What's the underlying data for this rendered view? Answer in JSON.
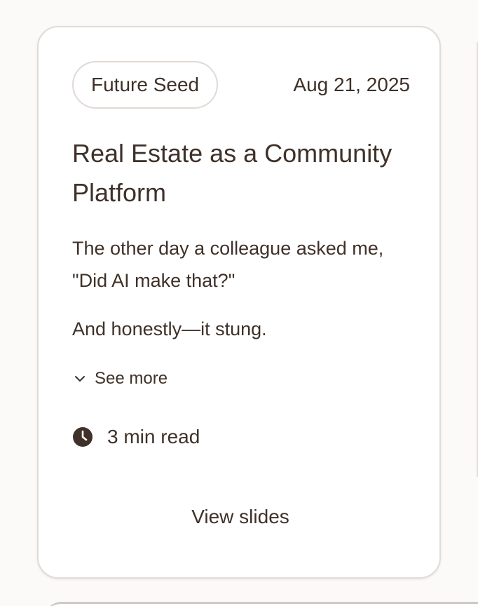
{
  "card": {
    "tag": "Future Seed",
    "date": "Aug 21, 2025",
    "title": "Real Estate as a Community Platform",
    "excerpt_1": "The other day a colleague asked me, \"Did AI make that?\"",
    "excerpt_2": "And honestly—it stung.",
    "see_more_label": "See more",
    "see_more_icon": "chevron-down-icon",
    "read_time": "3 min read",
    "read_time_icon": "clock-icon",
    "view_slides_label": "View slides"
  },
  "colors": {
    "background": "#fcfaf8",
    "card_background": "#ffffff",
    "card_border": "#e2dbd6",
    "text": "#3f3129"
  }
}
